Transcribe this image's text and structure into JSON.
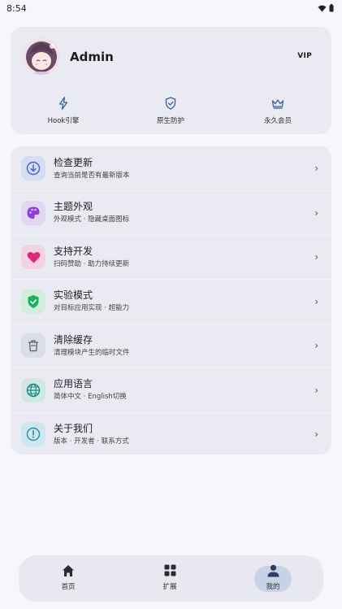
{
  "status": {
    "time": "8:54"
  },
  "profile": {
    "name": "Admin",
    "badge": "VIP",
    "quick": [
      {
        "label": "Hook引擎",
        "icon": "lightning-icon"
      },
      {
        "label": "原生防护",
        "icon": "shield-icon"
      },
      {
        "label": "永久会员",
        "icon": "crown-icon"
      }
    ]
  },
  "menu": [
    {
      "title": "检查更新",
      "subtitle": "查询当前是否有最新版本",
      "icon": "download-circle-icon",
      "color": "#3b66c4",
      "bg": "#d4ddf3"
    },
    {
      "title": "主题外观",
      "subtitle": "外观模式 · 隐藏桌面图标",
      "icon": "palette-icon",
      "color": "#8a3fd6",
      "bg": "#e2d7f1"
    },
    {
      "title": "支持开发",
      "subtitle": "扫码赞助 · 助力持续更新",
      "icon": "heart-icon",
      "color": "#e0287a",
      "bg": "#f2d3e1"
    },
    {
      "title": "实验模式",
      "subtitle": "对目标应用实现 · 超能力",
      "icon": "shield-check-icon",
      "color": "#19b15a",
      "bg": "#d3ecdc"
    },
    {
      "title": "清除缓存",
      "subtitle": "清理模块产生的临时文件",
      "icon": "trash-icon",
      "color": "#5a5f6b",
      "bg": "#dcdee5"
    },
    {
      "title": "应用语言",
      "subtitle": "简体中文 · English切换",
      "icon": "globe-icon",
      "color": "#128a7a",
      "bg": "#d0e7e3"
    },
    {
      "title": "关于我们",
      "subtitle": "版本 · 开发者 · 联系方式",
      "icon": "info-icon",
      "color": "#1a8fb0",
      "bg": "#cfe6ee"
    }
  ],
  "nav": [
    {
      "label": "首页",
      "icon": "home-icon"
    },
    {
      "label": "扩展",
      "icon": "grid-icon"
    },
    {
      "label": "我的",
      "icon": "person-icon",
      "active": true
    }
  ]
}
